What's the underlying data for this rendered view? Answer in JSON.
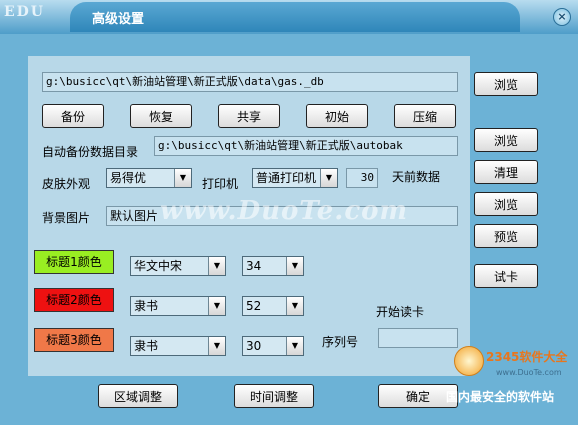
{
  "window": {
    "edu_logo": "EDU",
    "title": "高级设置",
    "close_glyph": "×"
  },
  "data_path": "g:\\busicc\\qt\\新油站管理\\新正式版\\data\\gas._db",
  "buttons": {
    "browse": "浏览",
    "backup": "备份",
    "restore": "恢复",
    "share": "共享",
    "init": "初始",
    "compress": "压缩",
    "clean": "清理",
    "preview": "预览",
    "test_card": "试卡",
    "region_adjust": "区域调整",
    "time_adjust": "时间调整",
    "ok": "确定"
  },
  "autobackup": {
    "label": "自动备份数据目录",
    "path": "g:\\busicc\\qt\\新油站管理\\新正式版\\autobak"
  },
  "skin": {
    "label": "皮肤外观",
    "value": "易得优"
  },
  "printer": {
    "label": "打印机",
    "value": "普通打印机"
  },
  "days": {
    "value": "30",
    "label": "天前数据"
  },
  "background": {
    "label": "背景图片",
    "value": "默认图片"
  },
  "titles": [
    {
      "label": "标题1颜色",
      "color": "#99ee22",
      "font": "华文中宋",
      "size": "34"
    },
    {
      "label": "标题2颜色",
      "color": "#ee1111",
      "font": "隶书",
      "size": "52"
    },
    {
      "label": "标题3颜色",
      "color": "#f07848",
      "font": "隶书",
      "size": "30"
    }
  ],
  "card": {
    "start_label": "开始读卡",
    "serial_label": "序列号",
    "serial_value": ""
  },
  "watermark": "www.DuoTe.com",
  "logo": {
    "brand": "2345软件大全",
    "site": "www.DuoTe.com",
    "slogan": "国内最安全的软件站"
  }
}
